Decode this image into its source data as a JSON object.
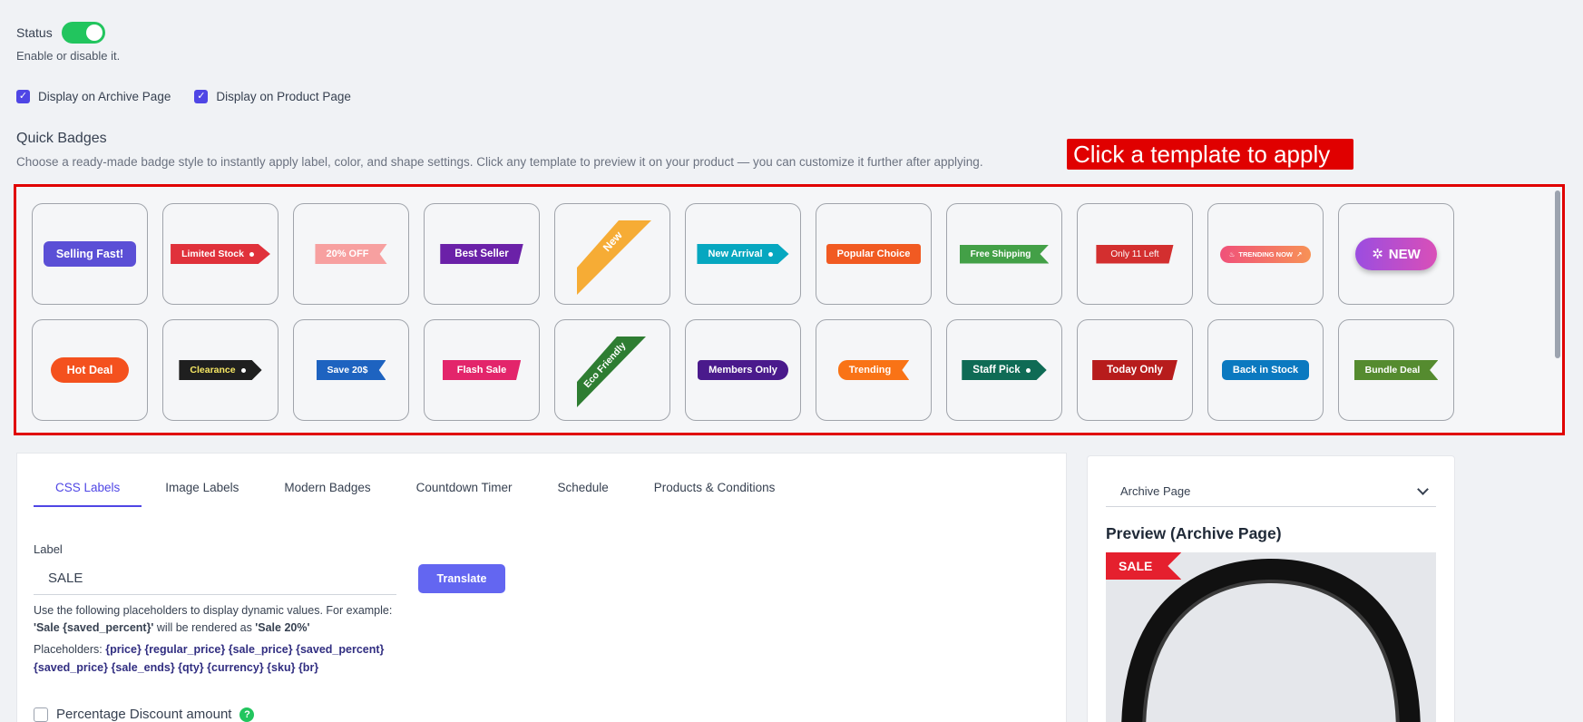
{
  "status": {
    "label": "Status",
    "help": "Enable or disable it.",
    "enabled": true
  },
  "display": {
    "archive": {
      "label": "Display on Archive Page",
      "checked": true
    },
    "product": {
      "label": "Display on Product Page",
      "checked": true
    }
  },
  "quick_badges": {
    "title": "Quick Badges",
    "description": "Choose a ready-made badge style to instantly apply label, color, and shape settings. Click any template to preview it on your product — you can customize it further after applying.",
    "callout": "Click a template to apply",
    "templates_row1": [
      {
        "label": "Selling Fast!",
        "color": "#5b4fd6"
      },
      {
        "label": "Limited Stock",
        "color": "#e0313b"
      },
      {
        "label": "20% OFF",
        "color": "#f7a0a0"
      },
      {
        "label": "Best Seller",
        "color": "#6b21a8"
      },
      {
        "label": "New",
        "color": "#f6ac35"
      },
      {
        "label": "New Arrival",
        "color": "#06a7c0"
      },
      {
        "label": "Popular Choice",
        "color": "#f15a22"
      },
      {
        "label": "Free Shipping",
        "color": "#43a047"
      },
      {
        "label": "Only 11 Left",
        "color": "#d32f2f"
      },
      {
        "label": "TRENDING NOW",
        "color": "#f0517a"
      },
      {
        "label": "NEW",
        "color": "#b44bd9"
      }
    ],
    "templates_row2": [
      {
        "label": "Hot Deal",
        "color": "#f4511e"
      },
      {
        "label": "Clearance",
        "color": "#1f1f1f"
      },
      {
        "label": "Save 20$",
        "color": "#1e63c0"
      },
      {
        "label": "Flash Sale",
        "color": "#e3256b"
      },
      {
        "label": "Eco Friendly",
        "color": "#2e7d32"
      },
      {
        "label": "Members Only",
        "color": "#4a1a8c"
      },
      {
        "label": "Trending",
        "color": "#f97316"
      },
      {
        "label": "Staff Pick",
        "color": "#0f6b55"
      },
      {
        "label": "Today Only",
        "color": "#b71c1c"
      },
      {
        "label": "Back in Stock",
        "color": "#0b79c0"
      },
      {
        "label": "Bundle Deal",
        "color": "#558b2f"
      }
    ]
  },
  "tabs": [
    "CSS Labels",
    "Image Labels",
    "Modern Badges",
    "Countdown Timer",
    "Schedule",
    "Products & Conditions"
  ],
  "active_tab": "CSS Labels",
  "form": {
    "label_title": "Label",
    "label_value": "SALE",
    "translate_button": "Translate",
    "help_line1": "Use the following placeholders to display dynamic values. For example:",
    "help_example_a": "'Sale {saved_percent}'",
    "help_example_mid": " will be rendered as ",
    "help_example_b": "'Sale 20%'",
    "placeholders_label": "Placeholders: ",
    "placeholders": [
      "{price}",
      "{regular_price}",
      "{sale_price}",
      "{saved_percent}",
      "{saved_price}",
      "{sale_ends}",
      "{qty}",
      "{currency}",
      "{sku}",
      "{br}"
    ],
    "percentage_label": "Percentage Discount amount",
    "percentage_checked": false
  },
  "preview": {
    "select_value": "Archive Page",
    "title": "Preview (Archive Page)",
    "badge_text": "SALE"
  },
  "icons": {
    "help": "question-icon",
    "select": "chevron-down-icon",
    "check": "checkmark-icon"
  }
}
